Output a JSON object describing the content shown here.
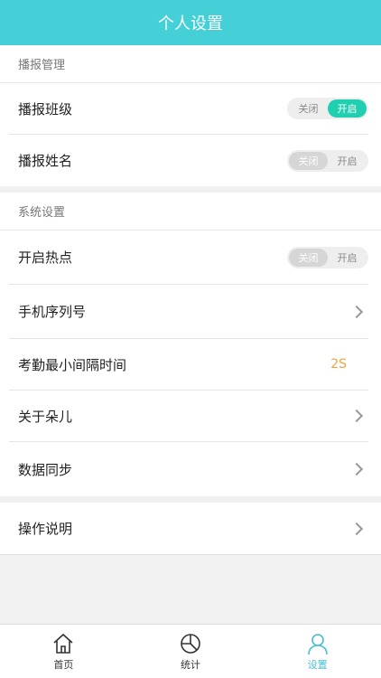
{
  "header": {
    "title": "个人设置"
  },
  "broadcast": {
    "section_title": "播报管理",
    "items": [
      {
        "label": "播报班级",
        "off": "关闭",
        "on": "开启",
        "state": "on"
      },
      {
        "label": "播报姓名",
        "off": "关闭",
        "on": "开启",
        "state": "off"
      }
    ]
  },
  "system": {
    "section_title": "系统设置",
    "hotspot": {
      "label": "开启热点",
      "off": "关闭",
      "on": "开启",
      "state": "off"
    },
    "serial": {
      "label": "手机序列号"
    },
    "interval": {
      "label": "考勤最小间隔时间",
      "value": "2S"
    },
    "about": {
      "label": "关于朵儿"
    },
    "sync": {
      "label": "数据同步"
    }
  },
  "instructions": {
    "label": "操作说明"
  },
  "tabbar": {
    "items": [
      {
        "label": "首页",
        "icon": "home-icon",
        "active": false
      },
      {
        "label": "统计",
        "icon": "chart-icon",
        "active": false
      },
      {
        "label": "设置",
        "icon": "user-icon",
        "active": true
      }
    ]
  },
  "colors": {
    "header": "#45d0d8",
    "toggle_on": "#20cfb0",
    "toggle_off": "#d6d6d6",
    "interval_value": "#f2a23a",
    "tab_active": "#45bfd0"
  }
}
